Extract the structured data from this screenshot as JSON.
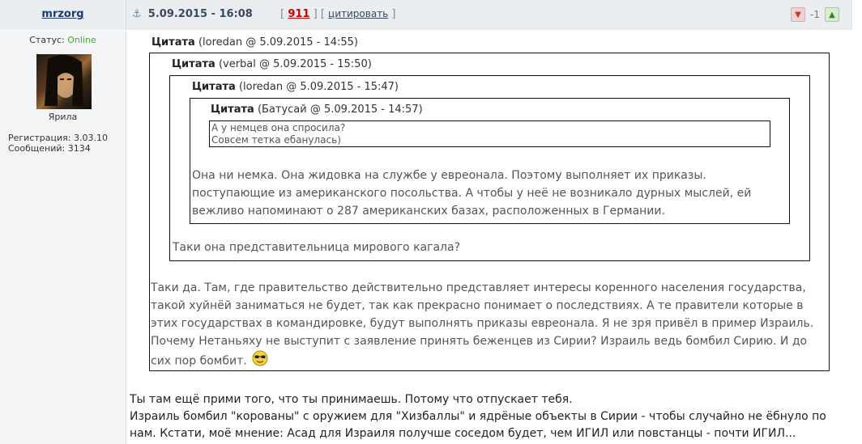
{
  "header": {
    "author": "mrzorg",
    "anchor_icon": "anchor-icon",
    "date": "5.09.2015 - 16:08",
    "post_number": "911",
    "quote_action": "цитировать",
    "rating": "-1"
  },
  "sidebar": {
    "status_label": "Статус:",
    "status_value": "Online",
    "avatar_caption": "Ярила",
    "registration": "Регистрация: 3.03.10",
    "messages": "Сообщений: 3134"
  },
  "quotes": [
    {
      "label": "Цитата",
      "meta": "(loredan @ 5.09.2015 - 14:55)",
      "text": "Таки да. Там, где правительство действительно представляет интересы коренного населения государства, такой хуйнёй заниматься не будет, так как прекрасно понимает о последствиях. А те правители которые в этих государствах в командировке, будут выполнять приказы евреонала. Я не зря привёл в пример Израиль. Почему Нетаньяху не выступит с заявление принять беженцев из Сирии? Израиль ведь бомбил Сирию. И до сих пор бомбит."
    },
    {
      "label": "Цитата",
      "meta": "(verbal @ 5.09.2015 - 15:50)",
      "text": "Таки она представительница мирового кагала?"
    },
    {
      "label": "Цитата",
      "meta": "(loredan @ 5.09.2015 - 15:47)",
      "text": "Она ни немка. Она жидовка на службе у евреонала. Поэтому выполняет их приказы. поступающие из американского посольства. А чтобы у неё не возникало дурных мыслей, ей вежливо напоминают о 287 американских базах, расположенных в Германии."
    },
    {
      "label": "Цитата",
      "meta": "(Батусай @ 5.09.2015 - 14:57)",
      "line1": "А у немцев она спросила?",
      "line2": "Совсем тетка ебанулась)"
    }
  ],
  "reply": {
    "line1": "Ты там ещё прими того, что ты принимаешь. Потому что отпускает тебя.",
    "line2": "Израиль бомбил \"корованы\" с оружием для \"Хизбаллы\" и ядрёные объекты в Сирии - чтобы случайно не ёбнуло по нам. Кстати, моё мнение: Асад для Израиля получше соседом будет, чем ИГИЛ или повстанцы - почти ИГИЛ..."
  },
  "icons": {
    "smiley": "cool-smiley-icon",
    "vote_down": "thumbs-down-icon",
    "vote_up": "thumbs-up-icon"
  }
}
